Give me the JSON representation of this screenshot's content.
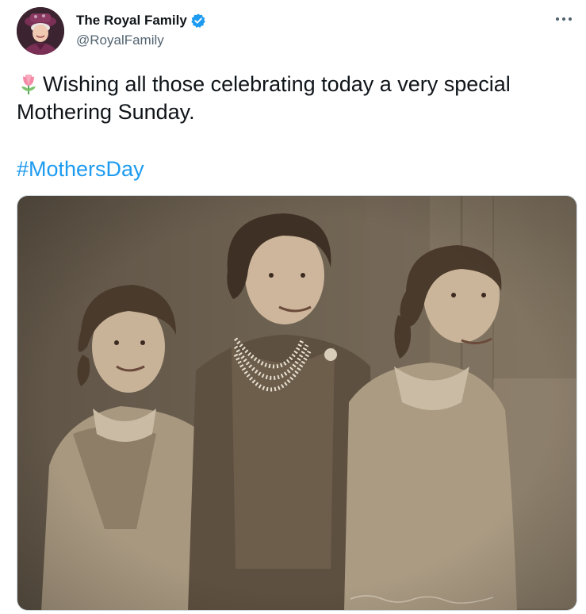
{
  "author": {
    "display_name": "The Royal Family",
    "handle": "@RoyalFamily",
    "verified": true,
    "avatar_icon": "avatar-photo"
  },
  "tweet": {
    "emoji_icon": "tulip-icon",
    "text": "Wishing all those celebrating today a very special Mothering Sunday.",
    "hashtag": "#MothersDay",
    "image_alt": "Sepia photograph of three women seated side by side, smiling and looking to the right"
  },
  "menu": {
    "icon": "more-options-icon"
  },
  "colors": {
    "text": "#0f1419",
    "secondary_text": "#536471",
    "link": "#1d9bf0",
    "verified": "#1d9bf0",
    "photo_tone": "#8a7a63"
  }
}
